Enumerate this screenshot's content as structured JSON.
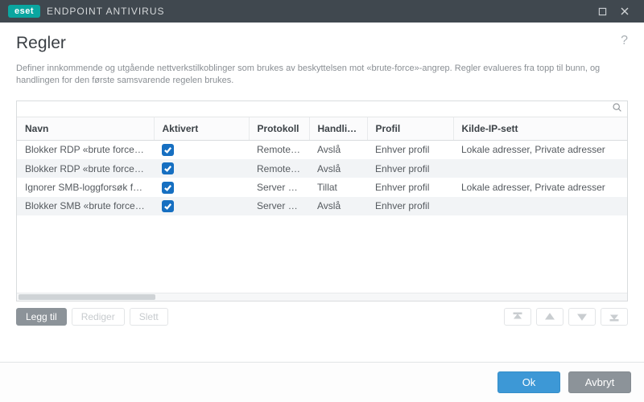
{
  "titlebar": {
    "brand_badge": "eset",
    "brand_text": "ENDPOINT ANTIVIRUS"
  },
  "page": {
    "title": "Regler",
    "description": "Definer innkommende og utgående nettverkstilkoblinger som brukes av beskyttelsen mot «brute-force»-angrep. Regler evalueres fra topp til bunn, og handlingen for den første samsvarende regelen brukes."
  },
  "columns": {
    "name": "Navn",
    "enabled": "Aktivert",
    "protocol": "Protokoll",
    "action": "Handling",
    "profile": "Profil",
    "source_ip": "Kilde-IP-sett"
  },
  "rows": [
    {
      "name": "Blokker RDP «brute force»-a...",
      "enabled": true,
      "protocol": "Remote De...",
      "action": "Avslå",
      "profile": "Enhver profil",
      "source_ip": "Lokale adresser, Private adresser"
    },
    {
      "name": "Blokker RDP «brute force»-a...",
      "enabled": true,
      "protocol": "Remote De...",
      "action": "Avslå",
      "profile": "Enhver profil",
      "source_ip": ""
    },
    {
      "name": "Ignorer SMB-loggforsøk fra ...",
      "enabled": true,
      "protocol": "Server Mes...",
      "action": "Tillat",
      "profile": "Enhver profil",
      "source_ip": "Lokale adresser, Private adresser"
    },
    {
      "name": "Blokker SMB «brute force»-a...",
      "enabled": true,
      "protocol": "Server Mes...",
      "action": "Avslå",
      "profile": "Enhver profil",
      "source_ip": ""
    }
  ],
  "toolbar": {
    "add": "Legg til",
    "edit": "Rediger",
    "delete": "Slett"
  },
  "footer": {
    "ok": "Ok",
    "cancel": "Avbryt"
  }
}
